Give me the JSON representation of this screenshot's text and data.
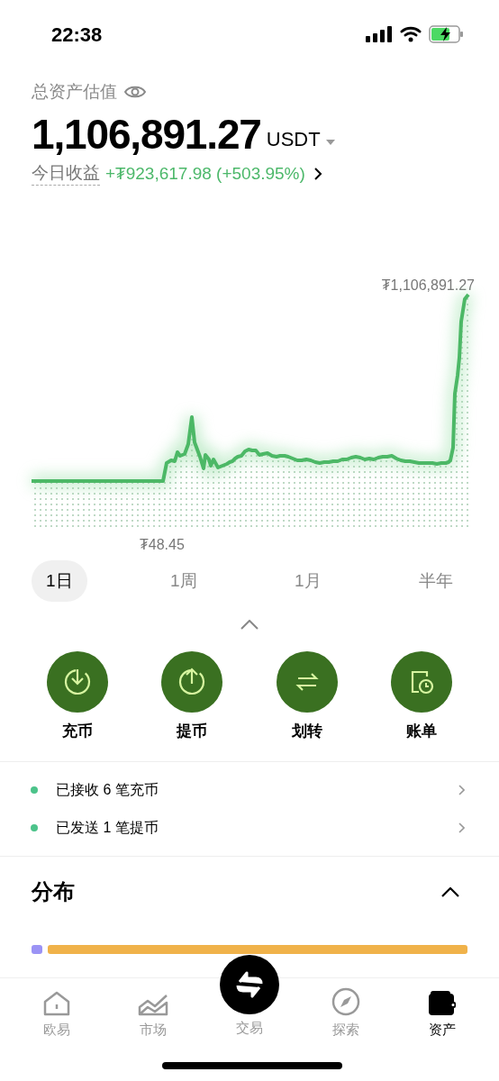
{
  "status_bar": {
    "time": "22:38"
  },
  "header": {
    "title": "总资产估值",
    "amount": "1,106,891.27",
    "currency": "USDT",
    "pnl_label": "今日收益",
    "pnl_value": "+₮923,617.98 (+503.95%)"
  },
  "chart": {
    "max_label": "₮1,106,891.27",
    "min_label": "₮48.45"
  },
  "range_tabs": [
    {
      "label": "1日",
      "selected": true
    },
    {
      "label": "1周",
      "selected": false
    },
    {
      "label": "1月",
      "selected": false
    },
    {
      "label": "半年",
      "selected": false
    }
  ],
  "actions": [
    {
      "kind": "deposit",
      "label": "充币"
    },
    {
      "kind": "withdraw",
      "label": "提币"
    },
    {
      "kind": "transfer",
      "label": "划转"
    },
    {
      "kind": "bill",
      "label": "账单"
    }
  ],
  "notifications": [
    {
      "text": "已接收 6 笔充币"
    },
    {
      "text": "已发送 1 笔提币"
    }
  ],
  "distribution": {
    "title": "分布",
    "segments": [
      {
        "color": "#9b93f5"
      },
      {
        "color": "#f0b24a"
      }
    ]
  },
  "nav": [
    {
      "kind": "home",
      "label": "欧易",
      "selected": false
    },
    {
      "kind": "market",
      "label": "市场",
      "selected": false
    },
    {
      "kind": "trade",
      "label": "交易",
      "selected": false
    },
    {
      "kind": "explore",
      "label": "探索",
      "selected": false
    },
    {
      "kind": "assets",
      "label": "资产",
      "selected": true
    }
  ]
}
